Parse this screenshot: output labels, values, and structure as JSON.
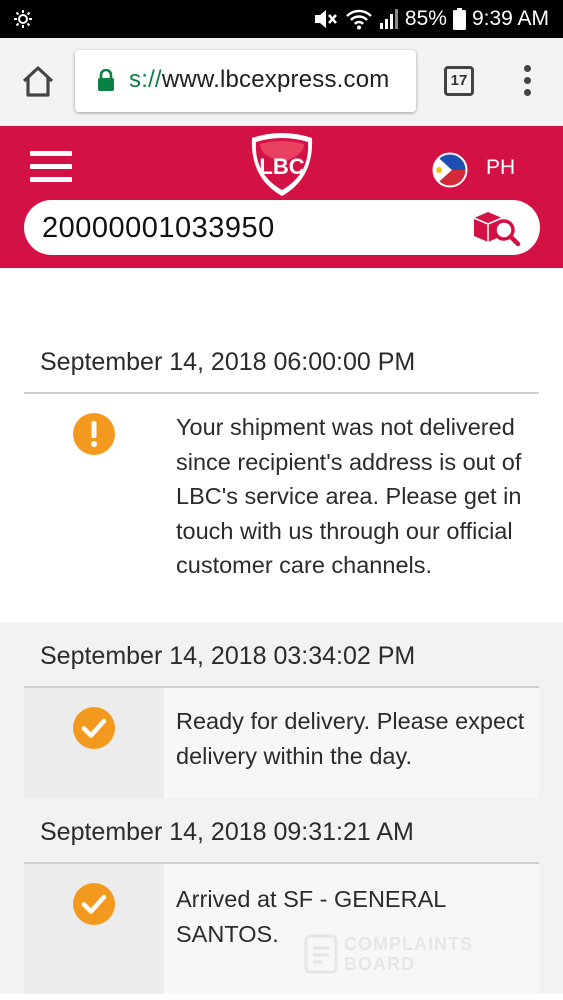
{
  "status_bar": {
    "battery": "85%",
    "time": "9:39 AM",
    "icons": [
      "weather-icon",
      "mute-icon",
      "wifi-icon",
      "signal-icon",
      "battery-icon"
    ]
  },
  "browser": {
    "url_scheme_fragment": "s://",
    "url_host": "www.lbcexpress.com",
    "tab_count": "17",
    "secure_color": "#0b8043"
  },
  "header": {
    "logo_text": "LBC",
    "country": "PH",
    "brand_color": "#d31145"
  },
  "search": {
    "tracking_number": "20000001033950"
  },
  "tracking": [
    {
      "date": "September 14, 2018 06:00:00 PM",
      "status_icon": "warning-icon",
      "message": "Your shipment was not delivered since recipient's address is out of LBC's service area. Please get in touch with us through our official customer care channels."
    },
    {
      "date": "September 14, 2018 03:34:02 PM",
      "status_icon": "check-icon",
      "message": "Ready for delivery. Please expect delivery within the day."
    },
    {
      "date": "September 14, 2018 09:31:21 AM",
      "status_icon": "check-icon",
      "message": "Arrived at SF - GENERAL SANTOS."
    }
  ],
  "status_colors": {
    "icon": "#f39a1e"
  },
  "watermark": {
    "line1": "COMPLAINTS",
    "line2": "BOARD"
  }
}
